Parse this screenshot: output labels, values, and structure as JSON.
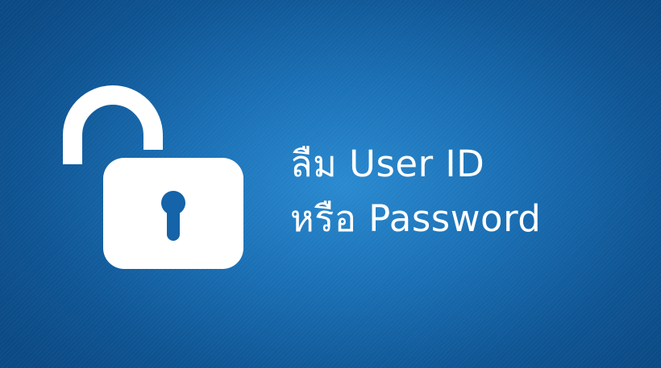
{
  "banner": {
    "headline_line1": "ลืม User ID",
    "headline_line2": "หรือ Password",
    "icon": "unlocked-padlock-icon"
  },
  "colors": {
    "background_center": "#2a8ad0",
    "background_edge": "#0b4a84",
    "foreground": "#ffffff"
  }
}
